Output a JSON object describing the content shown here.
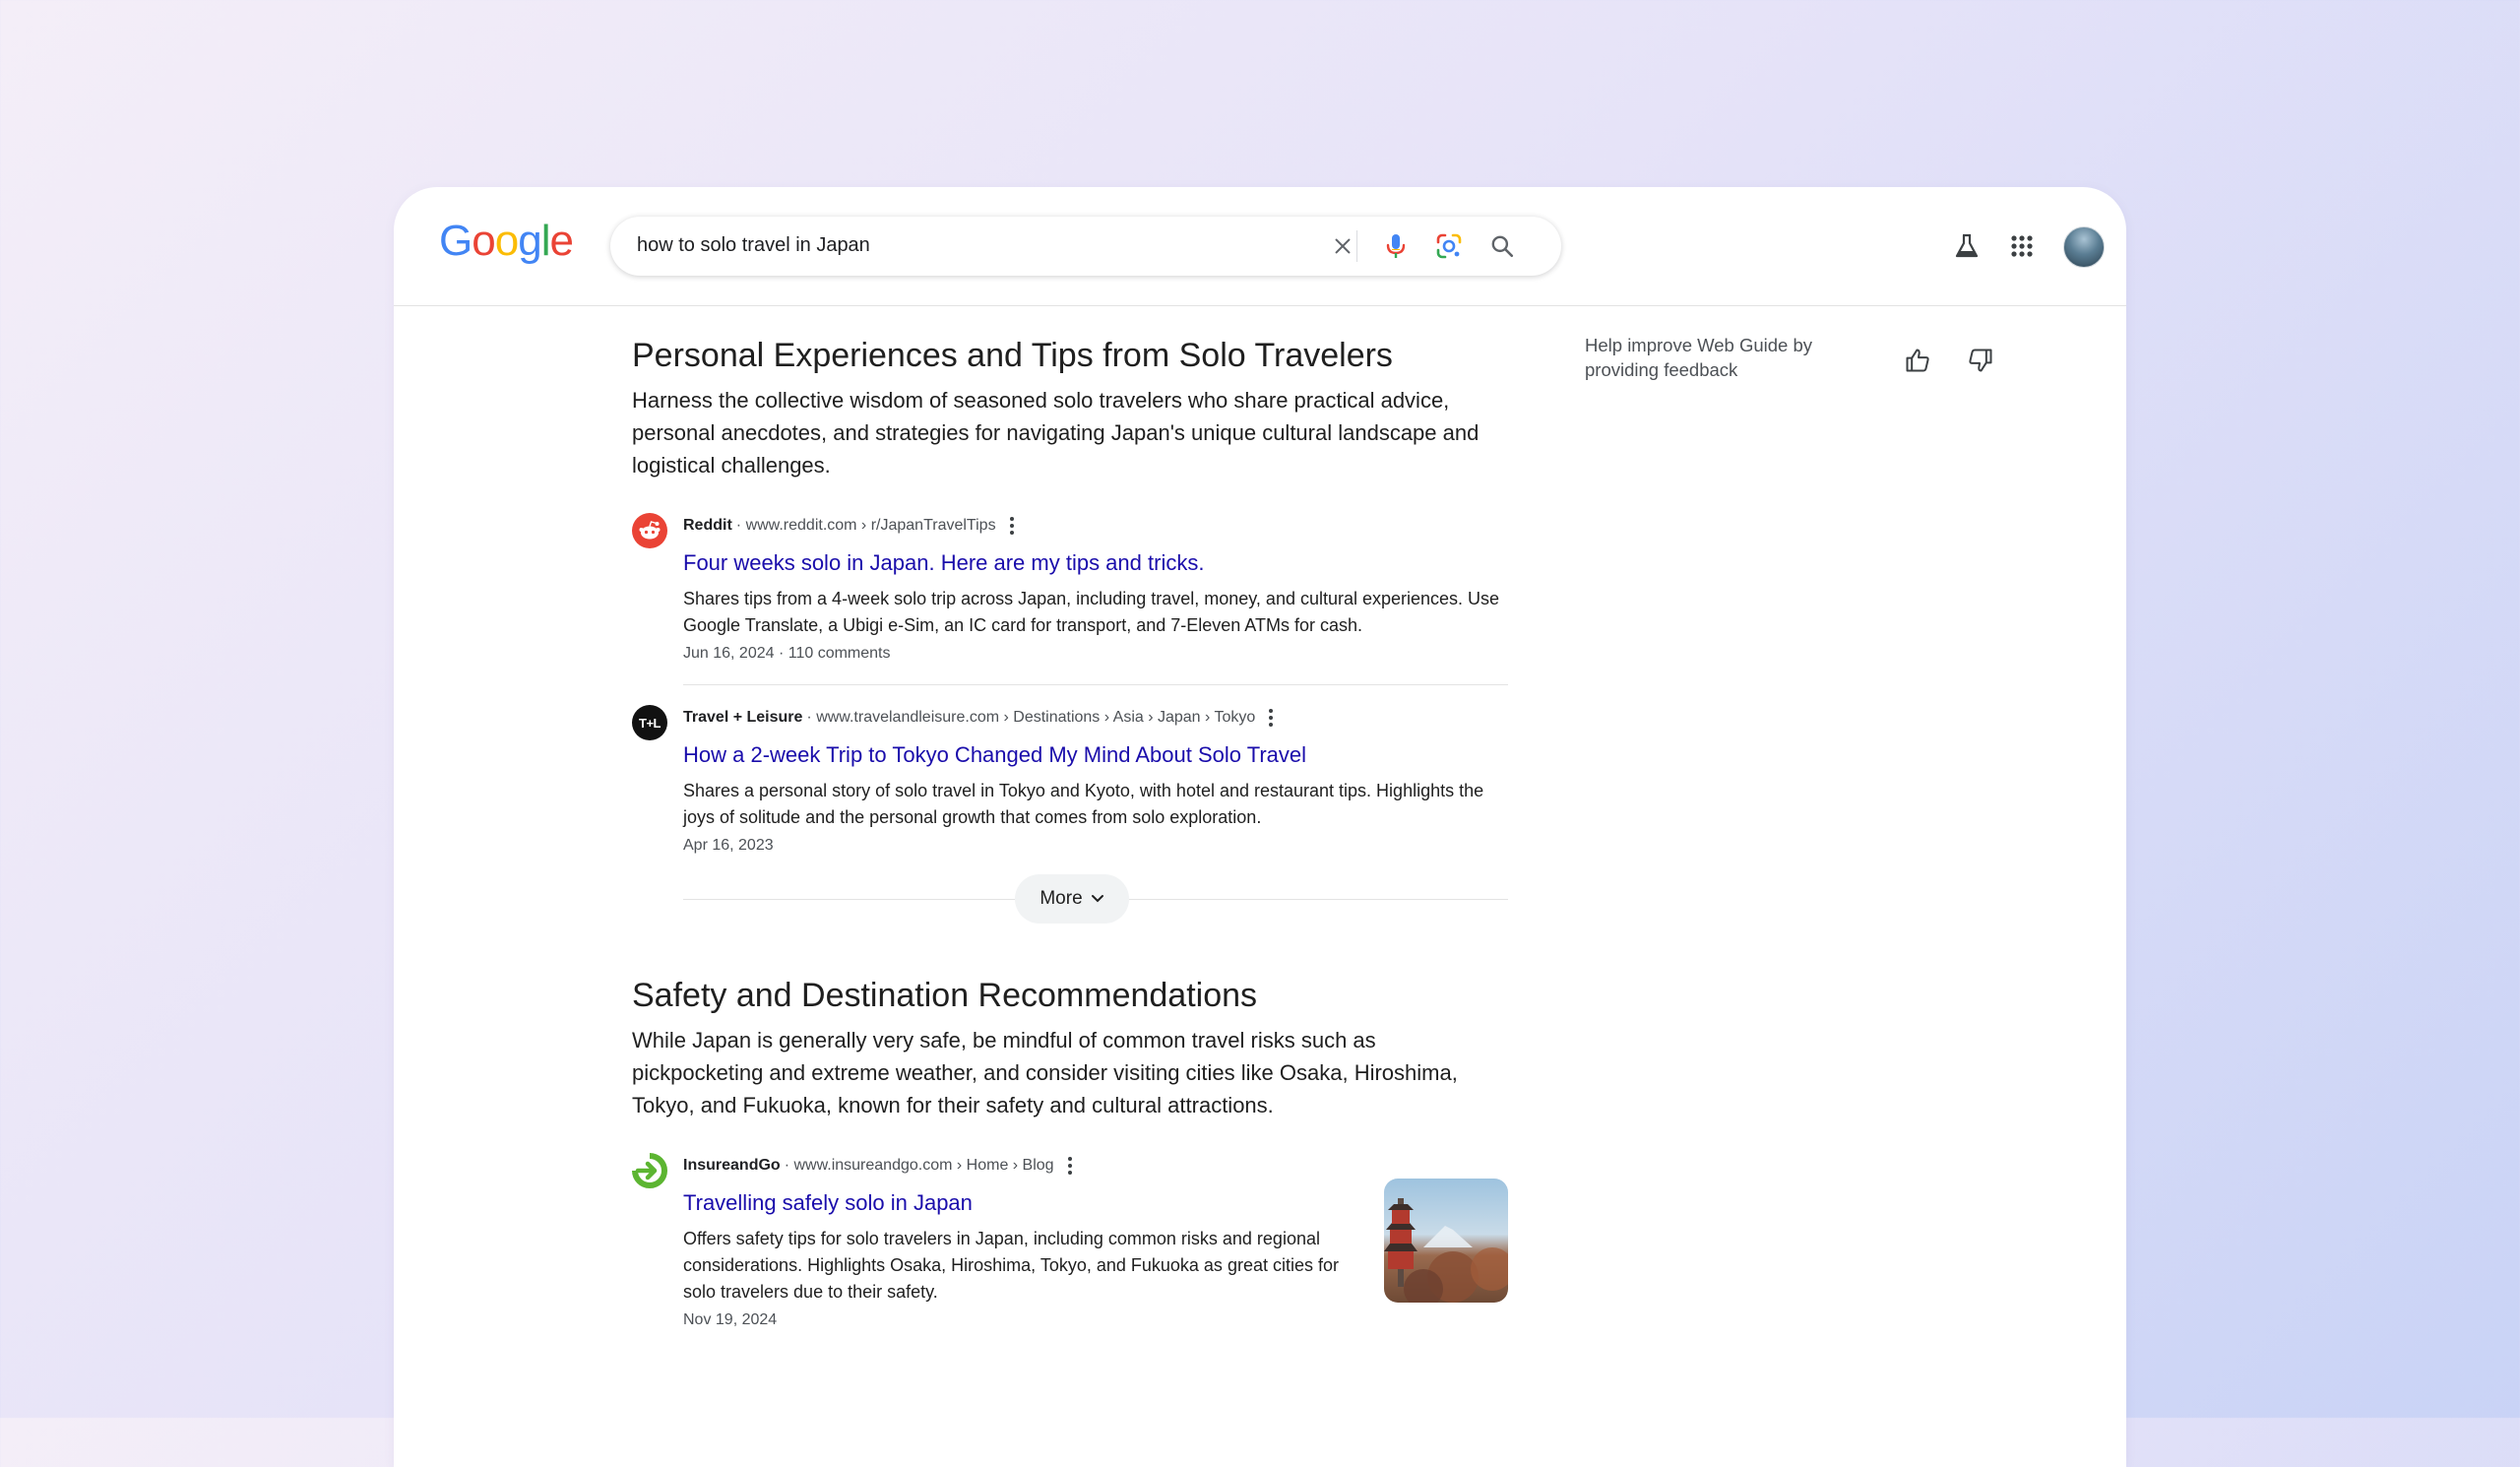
{
  "search": {
    "query": "how to solo travel in Japan"
  },
  "logo": {
    "letters": [
      "G",
      "o",
      "o",
      "g",
      "l",
      "e"
    ]
  },
  "icons": {
    "clear": "close-icon",
    "voice": "microphone-icon",
    "lens": "lens-icon",
    "search": "search-icon",
    "labs": "flask-icon",
    "apps": "apps-grid-icon",
    "account": "avatar"
  },
  "feedback": {
    "text": "Help improve Web Guide by providing feedback"
  },
  "sections": [
    {
      "title": "Personal Experiences and Tips from Solo Travelers",
      "description": "Harness the collective wisdom of seasoned solo travelers who share practical advice, personal anecdotes, and strategies for navigating Japan's unique cultural landscape and logistical challenges.",
      "results": [
        {
          "source": "Reddit",
          "url": "www.reddit.com › r/JapanTravelTips",
          "title": "Four weeks solo in Japan. Here are my tips and tricks.",
          "snippet": "Shares tips from a 4-week solo trip across Japan, including travel, money, and cultural experiences. Use Google Translate, a Ubigi e-Sim, an IC card for transport, and 7-Eleven ATMs for cash.",
          "meta": "Jun 16, 2024 · 110 comments"
        },
        {
          "source": "Travel + Leisure",
          "favicon_text": "T+L",
          "url": "www.travelandleisure.com › Destinations › Asia › Japan › Tokyo",
          "title": "How a 2-week Trip to Tokyo Changed My Mind About Solo Travel",
          "snippet": "Shares a personal story of solo travel in Tokyo and Kyoto, with hotel and restaurant tips. Highlights the joys of solitude and the personal growth that comes from solo exploration.",
          "meta": "Apr 16, 2023"
        }
      ],
      "more_label": "More"
    },
    {
      "title": "Safety and Destination Recommendations",
      "description": "While Japan is generally very safe, be mindful of common travel risks such as pickpocketing and extreme weather, and consider visiting cities like Osaka, Hiroshima, Tokyo, and Fukuoka, known for their safety and cultural attractions.",
      "results": [
        {
          "source": "InsureandGo",
          "url": "www.insureandgo.com › Home › Blog",
          "title": "Travelling safely solo in Japan",
          "snippet": "Offers safety tips for solo travelers in Japan, including common risks and regional considerations. Highlights Osaka, Hiroshima, Tokyo, and Fukuoka as great cities for solo travelers due to their safety.",
          "meta": "Nov 19, 2024"
        }
      ]
    }
  ],
  "colors": {
    "link": "#1a0dab",
    "reddit": "#ff4500",
    "insureandgo": "#5cb531"
  }
}
